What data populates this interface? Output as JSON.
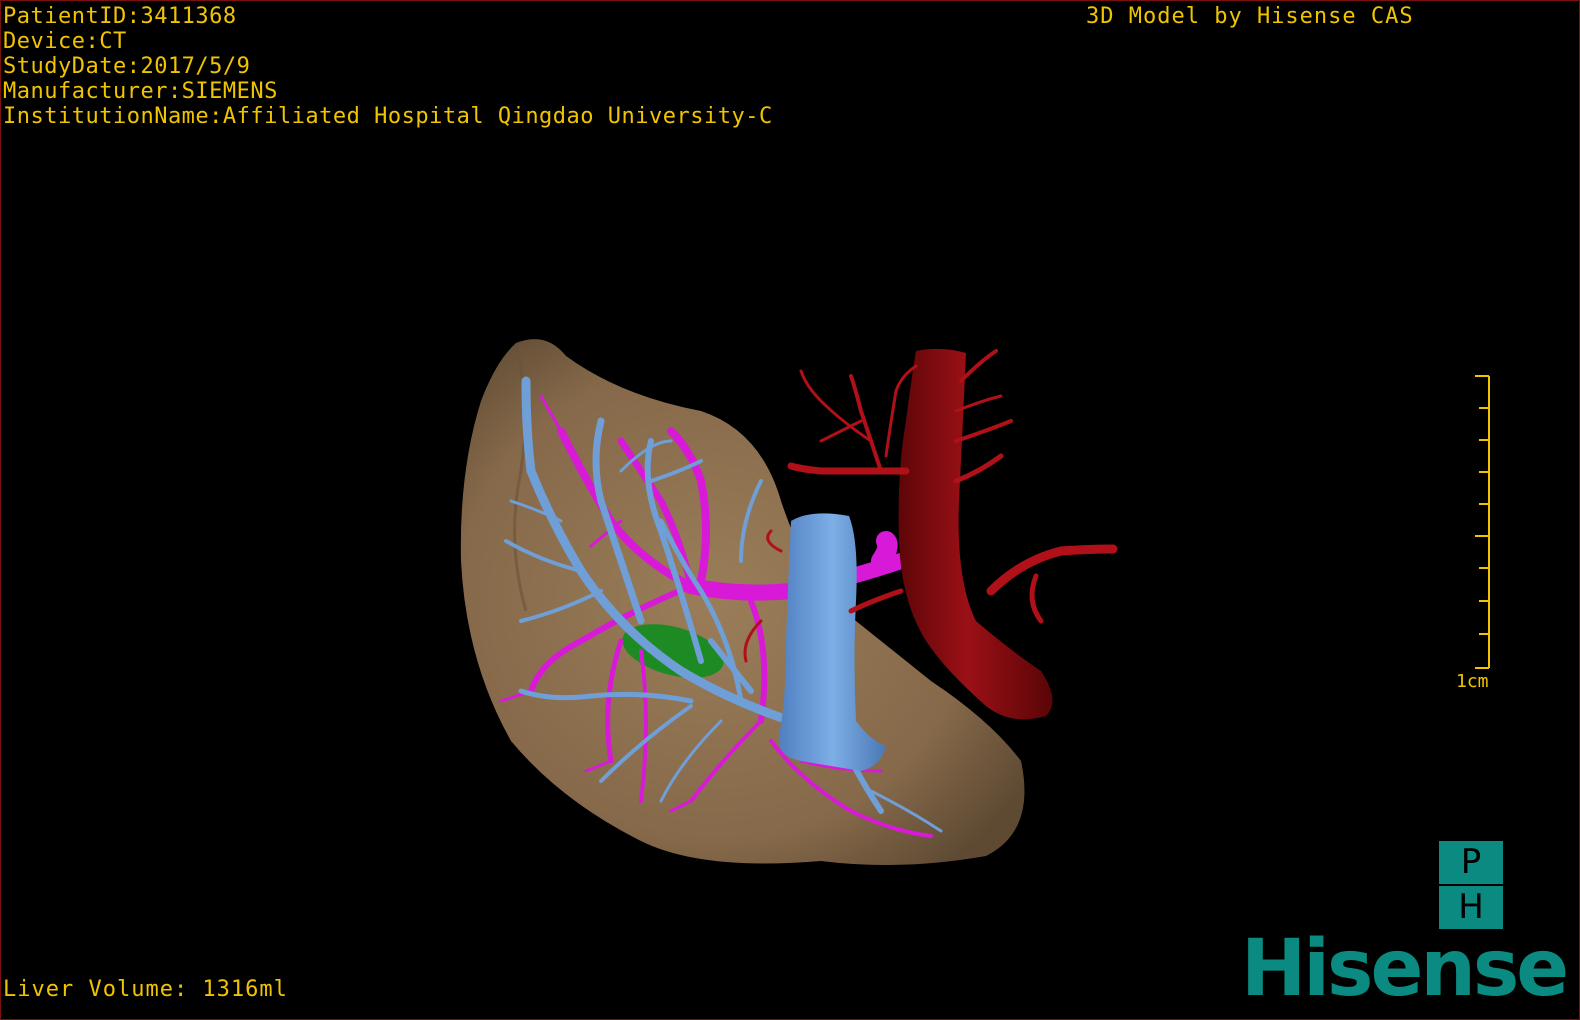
{
  "patient_info": {
    "patient_id": "PatientID:3411368",
    "device": "Device:CT",
    "study_date": "StudyDate:2017/5/9",
    "manufacturer": "Manufacturer:SIEMENS",
    "institution": "InstitutionName:Affiliated Hospital Qingdao University-C"
  },
  "model_credit": "3D Model by Hisense CAS",
  "liver_volume": "Liver Volume: 1316ml",
  "scale_bar": {
    "label": "1cm"
  },
  "logo": {
    "badge_top": "P",
    "badge_bottom": "H",
    "brand": "Hisense"
  },
  "colors": {
    "overlay_text": "#f0c400",
    "liver": "#8b6f4e",
    "hepatic_vein": "#6f9fd6",
    "portal_vein": "#d81ad8",
    "aorta": "#8a0c12",
    "artery": "#b01018",
    "gallbladder": "#1e8a24",
    "brand": "#0a8a80"
  }
}
